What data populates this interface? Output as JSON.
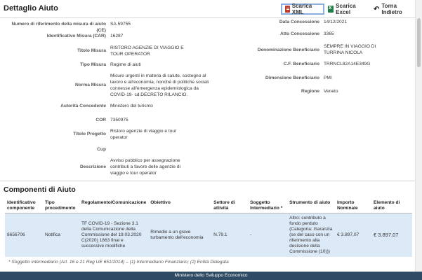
{
  "header": {
    "title": "Dettaglio Aiuto",
    "buttons": {
      "xml": "Scarica XML",
      "excel": "Scarica Excel",
      "back": "Torna Indietro"
    }
  },
  "left_fields": {
    "numero_riferimento": {
      "label": "Numero di riferimento della misura di aiuto (CE)",
      "value": "SA.59755"
    },
    "car": {
      "label": "Identificativo Misura (CAR)",
      "value": "16287"
    },
    "titolo_misura": {
      "label": "Titolo Misura",
      "value": "RISTORO AGENZIE DI VIAGGIO E TOUR OPERATOR"
    },
    "tipo_misura": {
      "label": "Tipo Misura",
      "value": "Regime di aiuti"
    },
    "norma_misura": {
      "label": "Norma Misura",
      "value": "Misure urgenti in materia di salute, sostegno al lavoro e all'economia, nonché di politiche sociali connesse all'emergenza epidemiologica da COVID-19- cd.DECRETO RILANCIO."
    },
    "autorita": {
      "label": "Autorità Concedente",
      "value": "Ministero del turismo"
    },
    "cor": {
      "label": "COR",
      "value": "7350975"
    },
    "titolo_progetto": {
      "label": "Titolo Progetto",
      "value": "Ristoro agenzie di viaggio e tour operator"
    },
    "cup": {
      "label": "Cup",
      "value": ""
    },
    "descrizione": {
      "label": "Descrizione",
      "value": "Avviso pubblico per assegnazione contributi a favore delle agenzie di viaggio e tour operator"
    }
  },
  "right_fields": {
    "data_concessione": {
      "label": "Data Concessione",
      "value": "14/12/2021"
    },
    "atto_concessione": {
      "label": "Atto Concessione",
      "value": "3365"
    },
    "denominazione": {
      "label": "Denominazione Beneficiario",
      "value": "SEMPRE IN VIAGGIO DI TURRINA NICOLA"
    },
    "cf": {
      "label": "C.F. Beneficiario",
      "value": "TRRNCL82A14E349G"
    },
    "dimensione": {
      "label": "Dimensione Beneficiario",
      "value": "PMI"
    },
    "regione": {
      "label": "Regione",
      "value": "Veneto"
    }
  },
  "components": {
    "title": "Componenti di Aiuto",
    "columns": [
      "Identificativo componente",
      "Tipo procedimento",
      "Regolamento/Comunicazione",
      "Obiettivo",
      "Settore di attività",
      "Soggetto Intermediario *",
      "Strumento di aiuto",
      "Importo Nominale",
      "Elemento di aiuto"
    ],
    "rows": [
      {
        "id": "8656706",
        "tipo": "Notifica",
        "regolamento": "TF COVID-19 - Sezione 3.1 della Comunicazione della Commissione del 19.03.2020 C(2020) 1863 final e successive modifiche",
        "obiettivo": "Rimedio a un grave turbamento dell'economia",
        "settore": "N.79.1",
        "soggetto": "-",
        "strumento": "Altro: contributo a fondo perduto (Categoria: Garanzia (se del caso con un riferimento alla decisione della Commissione (10)))",
        "importo": "€ 3.897,07",
        "elemento": "€ 3.897,07"
      }
    ]
  },
  "footnote": "* Soggetto intermediario (Art. 16 e 21 Reg UE 651/2014) – (1) Intermediario Finanziario; (2) Entità Delegata",
  "footer": "Ministero dello Sviluppo Economico"
}
